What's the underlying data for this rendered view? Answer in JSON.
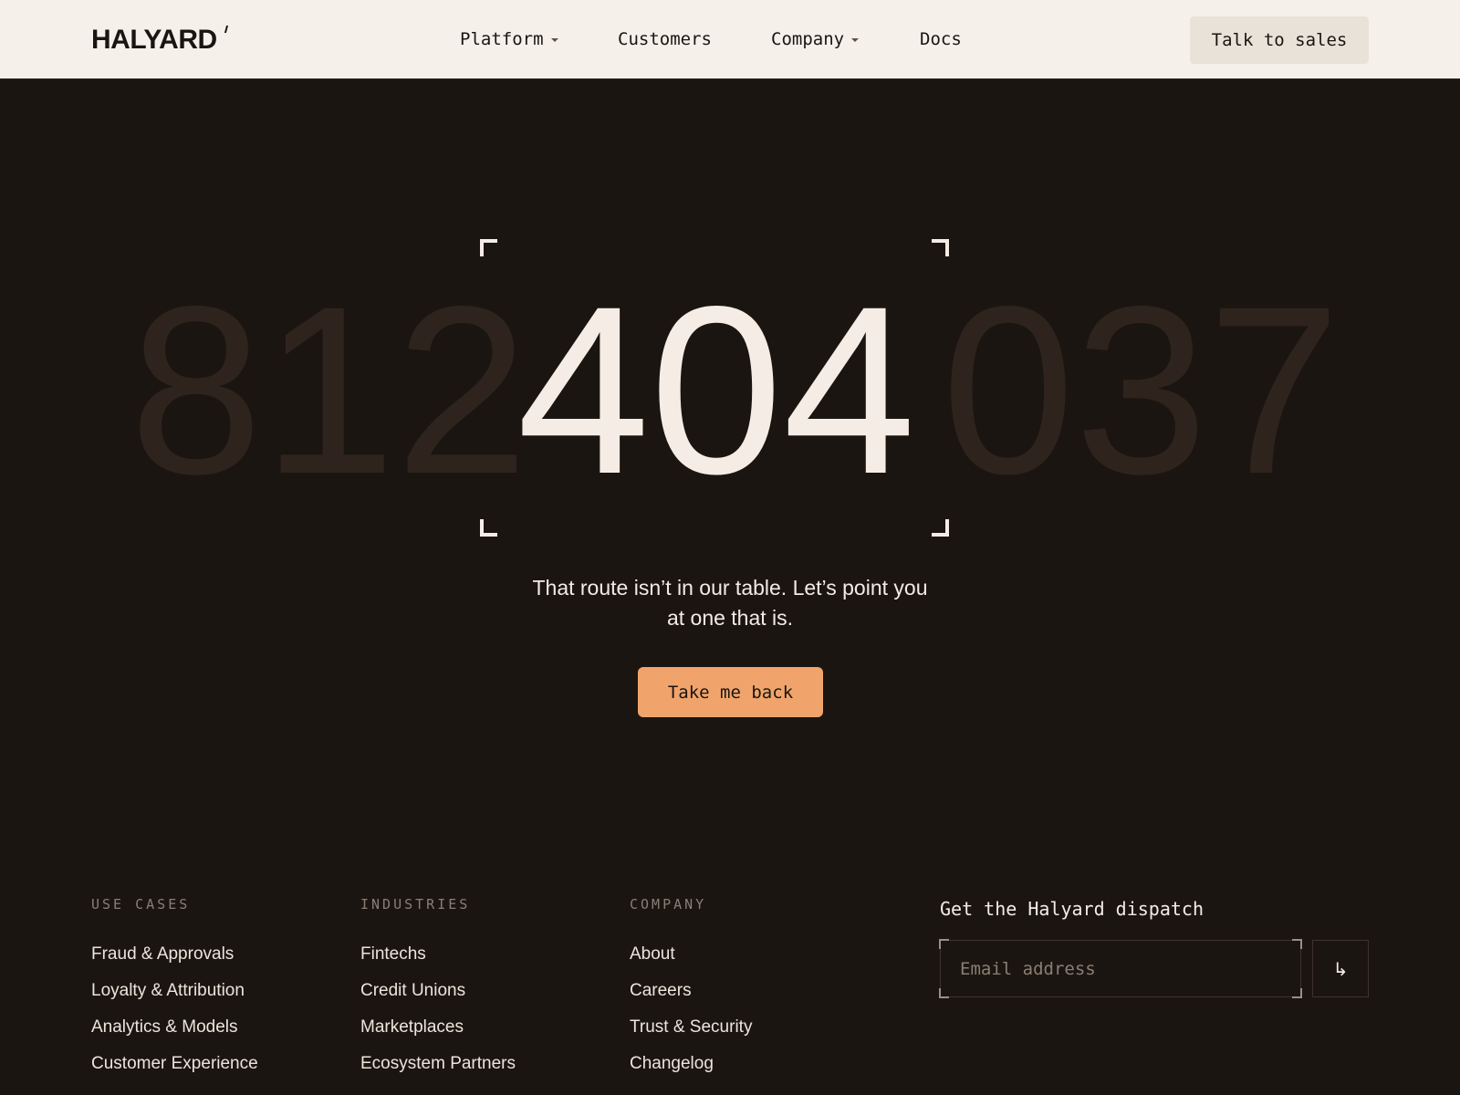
{
  "header": {
    "logo": "HALYARD",
    "nav": [
      {
        "label": "Platform",
        "has_dropdown": true
      },
      {
        "label": "Customers",
        "has_dropdown": false
      },
      {
        "label": "Company",
        "has_dropdown": true
      },
      {
        "label": "Docs",
        "has_dropdown": false
      }
    ],
    "cta_label": "Talk to sales"
  },
  "hero": {
    "ghost_left": "812",
    "code": "404",
    "ghost_right": "037",
    "message": "That route isn’t in our table. Let’s point you at one that is.",
    "button_label": "Take me back"
  },
  "footer": {
    "columns": [
      {
        "heading": "USE CASES",
        "links": [
          "Fraud & Approvals",
          "Loyalty & Attribution",
          "Analytics & Models",
          "Customer Experience"
        ]
      },
      {
        "heading": "INDUSTRIES",
        "links": [
          "Fintechs",
          "Credit Unions",
          "Marketplaces",
          "Ecosystem Partners"
        ]
      },
      {
        "heading": "COMPANY",
        "links": [
          "About",
          "Careers",
          "Trust & Security",
          "Changelog"
        ]
      }
    ],
    "newsletter": {
      "title": "Get the Halyard dispatch",
      "placeholder": "Email address",
      "submit_icon": "return-arrow-icon",
      "submit_glyph": "↳"
    }
  },
  "colors": {
    "background": "#1b1511",
    "header_bg": "#f5f1ea",
    "accent": "#f0a46b",
    "ghost_digits": "#2e241d",
    "text_light": "#f3ece4"
  }
}
